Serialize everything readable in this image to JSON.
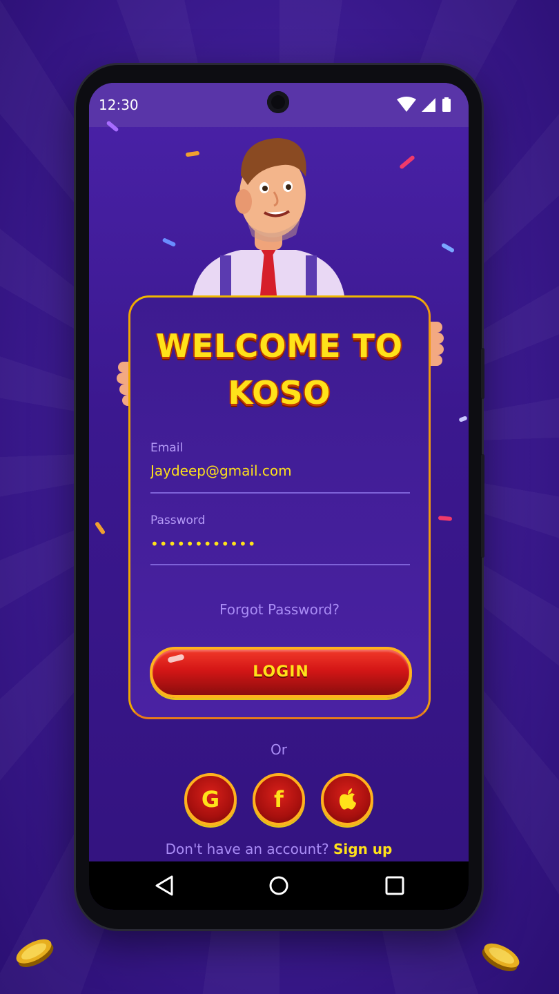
{
  "status_bar": {
    "time": "12:30",
    "icons": [
      "wifi-icon",
      "signal-icon",
      "battery-icon"
    ]
  },
  "card": {
    "title_line1": "WELCOME TO",
    "title_line2": "KOSO"
  },
  "form": {
    "email_label": "Email",
    "email_value": "Jaydeep@gmail.com",
    "password_label": "Password",
    "password_value": "••••••••••••",
    "forgot_label": "Forgot Password?",
    "login_label": "LOGIN"
  },
  "social": {
    "or_label": "Or",
    "buttons": [
      {
        "name": "google",
        "glyph": "G"
      },
      {
        "name": "facebook",
        "glyph": "f"
      },
      {
        "name": "apple",
        "glyph": "apple-icon"
      }
    ]
  },
  "signup": {
    "prompt": "Don't have an account?",
    "link": "Sign up"
  },
  "nav": [
    "back-icon",
    "home-icon",
    "recents-icon"
  ],
  "colors": {
    "accent_yellow": "#ffe21a",
    "button_red": "#d41616",
    "bg_purple": "#3b188f",
    "muted_purple": "#a98cf5"
  }
}
